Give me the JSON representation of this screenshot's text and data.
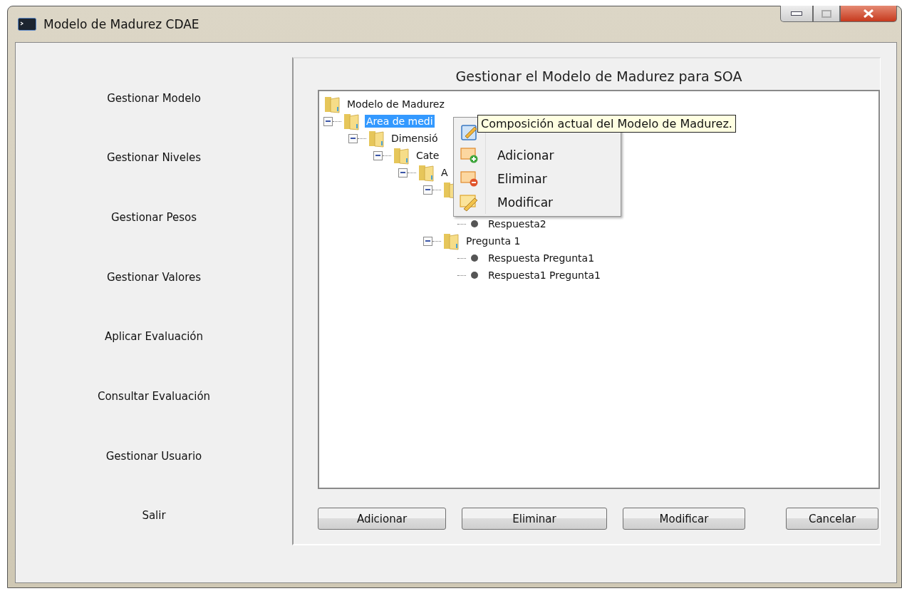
{
  "window": {
    "title": "Modelo de Madurez CDAE"
  },
  "sidebar": {
    "items": [
      "Gestionar Modelo",
      "Gestionar Niveles",
      "Gestionar Pesos",
      "Gestionar Valores",
      "Aplicar Evaluación",
      "Consultar Evaluación",
      "Gestionar Usuario",
      "Salir"
    ]
  },
  "panel": {
    "title": "Gestionar el Modelo de Madurez para SOA",
    "tree": [
      {
        "kind": "folder",
        "label": "Modelo de Madurez",
        "selected": false,
        "children": [
          {
            "kind": "folder",
            "label": "Area de medi",
            "selected": true,
            "expanded": true,
            "children": [
              {
                "kind": "folder",
                "label": "Dimensió",
                "selected": false,
                "expanded": true,
                "children": [
                  {
                    "kind": "folder",
                    "label": "Cate",
                    "selected": false,
                    "expanded": true,
                    "children": [
                      {
                        "kind": "folder",
                        "label": "A",
                        "selected": false,
                        "expanded": true,
                        "children": [
                          {
                            "kind": "folder",
                            "expanded": true,
                            "children": [
                              {
                                "kind": "hidden"
                              },
                              {
                                "kind": "leaf",
                                "label": "Respuesta2",
                                "selected": false
                              }
                            ]
                          },
                          {
                            "kind": "folder",
                            "label": "Pregunta 1",
                            "selected": false,
                            "expanded": true,
                            "children": [
                              {
                                "kind": "leaf",
                                "label": "Respuesta Pregunta1",
                                "selected": false
                              },
                              {
                                "kind": "leaf",
                                "label": "Respuesta1 Pregunta1",
                                "selected": false
                              }
                            ]
                          }
                        ]
                      }
                    ]
                  }
                ]
              }
            ]
          }
        ]
      }
    ],
    "context_menu": [
      {
        "kind": "view"
      },
      {
        "kind": "add",
        "label": "Adicionar"
      },
      {
        "kind": "remove",
        "label": "Eliminar"
      },
      {
        "kind": "edit",
        "label": "Modificar"
      }
    ],
    "tooltip": "Composición actual del Modelo de Madurez.",
    "buttons": [
      "Adicionar",
      "Eliminar",
      "Modificar"
    ],
    "cancel_button": "Cancelar"
  }
}
